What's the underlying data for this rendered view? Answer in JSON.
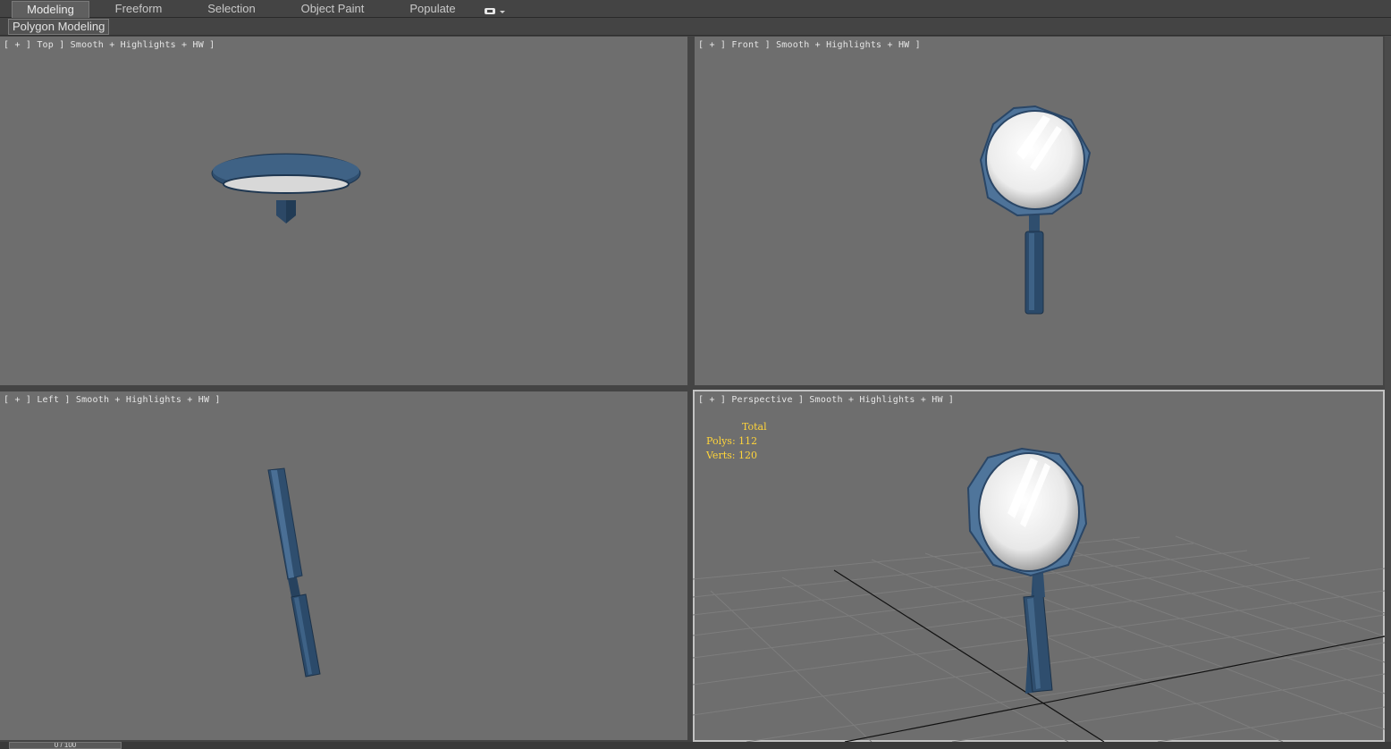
{
  "ribbon": {
    "tabs": [
      {
        "label": "Modeling",
        "active": true
      },
      {
        "label": "Freeform"
      },
      {
        "label": "Selection"
      },
      {
        "label": "Object Paint"
      },
      {
        "label": "Populate"
      }
    ],
    "subtab": "Polygon Modeling"
  },
  "viewports": {
    "top": {
      "label": "[ + ] Top ] Smooth + Highlights + HW ]"
    },
    "front": {
      "label": "[ + ] Front ] Smooth + Highlights + HW ]"
    },
    "left": {
      "label": "[ + ] Left ] Smooth + Highlights + HW ]"
    },
    "perspective": {
      "label": "[ + ] Perspective ] Smooth + Highlights + HW ]"
    }
  },
  "stats": {
    "total_label": "Total",
    "polys": "Polys: 112",
    "verts": "Verts: 120"
  },
  "timeline": {
    "frame": "0 / 100"
  },
  "colors": {
    "viewport_bg": "#6e6e6e",
    "model_blue": "#2f4e6e",
    "stats_yellow": "#ffd43a"
  }
}
